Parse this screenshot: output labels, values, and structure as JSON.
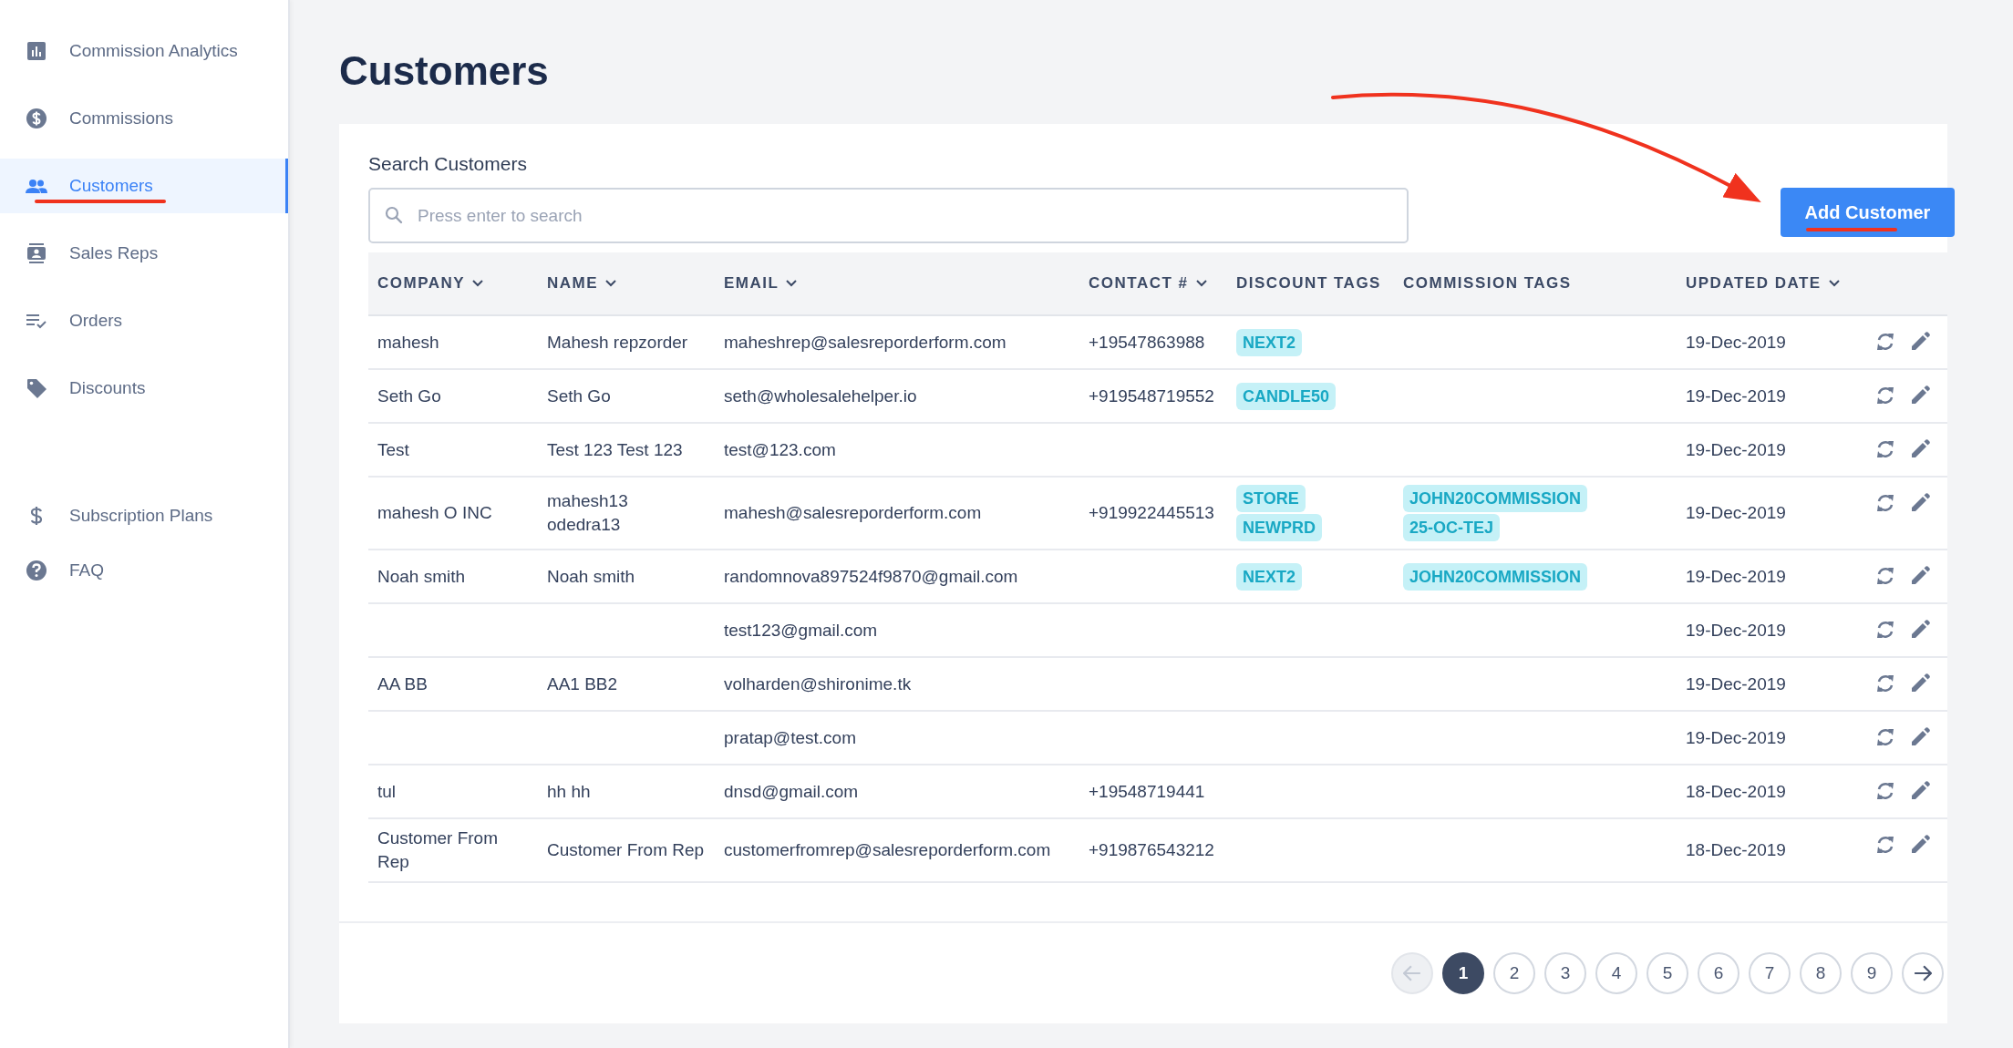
{
  "sidebar": {
    "groups": [
      [
        {
          "label": "Commission Analytics",
          "selected": false
        },
        {
          "label": "Commissions",
          "selected": false
        },
        {
          "label": "Customers",
          "selected": true
        },
        {
          "label": "Sales Reps",
          "selected": false
        },
        {
          "label": "Orders",
          "selected": false
        },
        {
          "label": "Discounts",
          "selected": false
        }
      ],
      [
        {
          "label": "Subscription Plans",
          "selected": false
        },
        {
          "label": "FAQ",
          "selected": false
        }
      ]
    ]
  },
  "page": {
    "title": "Customers"
  },
  "search": {
    "label": "Search Customers",
    "placeholder": "Press enter to search"
  },
  "add_button": {
    "label": "Add Customer"
  },
  "table": {
    "columns": [
      {
        "label": "COMPANY",
        "sortable": true
      },
      {
        "label": "NAME",
        "sortable": true
      },
      {
        "label": "EMAIL",
        "sortable": true
      },
      {
        "label": "CONTACT #",
        "sortable": true
      },
      {
        "label": "DISCOUNT TAGS",
        "sortable": false
      },
      {
        "label": "COMMISSION TAGS",
        "sortable": false
      },
      {
        "label": "UPDATED DATE",
        "sortable": true
      }
    ],
    "rows": [
      {
        "company": "mahesh",
        "name": "Mahesh repzorder",
        "email": "maheshrep@salesreporderform.com",
        "contact": "+19547863988",
        "discount_tags": [
          "NEXT2"
        ],
        "commission_tags": [],
        "updated": "19-Dec-2019"
      },
      {
        "company": "Seth Go",
        "name": "Seth Go",
        "email": "seth@wholesalehelper.io",
        "contact": "+919548719552",
        "discount_tags": [
          "CANDLE50"
        ],
        "commission_tags": [],
        "updated": "19-Dec-2019"
      },
      {
        "company": "Test",
        "name": "Test 123 Test 123",
        "email": "test@123.com",
        "contact": "",
        "discount_tags": [],
        "commission_tags": [],
        "updated": "19-Dec-2019"
      },
      {
        "company": "mahesh O INC",
        "name": "mahesh13 odedra13",
        "email": "mahesh@salesreporderform.com",
        "contact": "+919922445513",
        "discount_tags": [
          "STORE",
          "NEWPRD"
        ],
        "commission_tags": [
          "JOHN20COMMISSION",
          "25-OC-TEJ"
        ],
        "updated": "19-Dec-2019"
      },
      {
        "company": "Noah smith",
        "name": "Noah smith",
        "email": "randomnova897524f9870@gmail.com",
        "contact": "",
        "discount_tags": [
          "NEXT2"
        ],
        "commission_tags": [
          "JOHN20COMMISSION"
        ],
        "updated": "19-Dec-2019"
      },
      {
        "company": "",
        "name": "",
        "email": "test123@gmail.com",
        "contact": "",
        "discount_tags": [],
        "commission_tags": [],
        "updated": "19-Dec-2019"
      },
      {
        "company": "AA BB",
        "name": "AA1 BB2",
        "email": "volharden@shironime.tk",
        "contact": "",
        "discount_tags": [],
        "commission_tags": [],
        "updated": "19-Dec-2019"
      },
      {
        "company": "",
        "name": "",
        "email": "pratap@test.com",
        "contact": "",
        "discount_tags": [],
        "commission_tags": [],
        "updated": "19-Dec-2019"
      },
      {
        "company": "tul",
        "name": "hh hh",
        "email": "dnsd@gmail.com",
        "contact": "+19548719441",
        "discount_tags": [],
        "commission_tags": [],
        "updated": "18-Dec-2019"
      },
      {
        "company": "Customer From Rep",
        "name": "Customer From Rep",
        "email": "customerfromrep@salesreporderform.com",
        "contact": "+919876543212",
        "discount_tags": [],
        "commission_tags": [],
        "updated": "18-Dec-2019"
      }
    ]
  },
  "pagination": {
    "previous_disabled": true,
    "pages": [
      {
        "label": "1",
        "selected": true
      },
      {
        "label": "2",
        "selected": false
      },
      {
        "label": "3",
        "selected": false
      },
      {
        "label": "4",
        "selected": false
      },
      {
        "label": "5",
        "selected": false
      },
      {
        "label": "6",
        "selected": false
      },
      {
        "label": "7",
        "selected": false
      },
      {
        "label": "8",
        "selected": false
      },
      {
        "label": "9",
        "selected": false
      }
    ],
    "next_disabled": false
  }
}
